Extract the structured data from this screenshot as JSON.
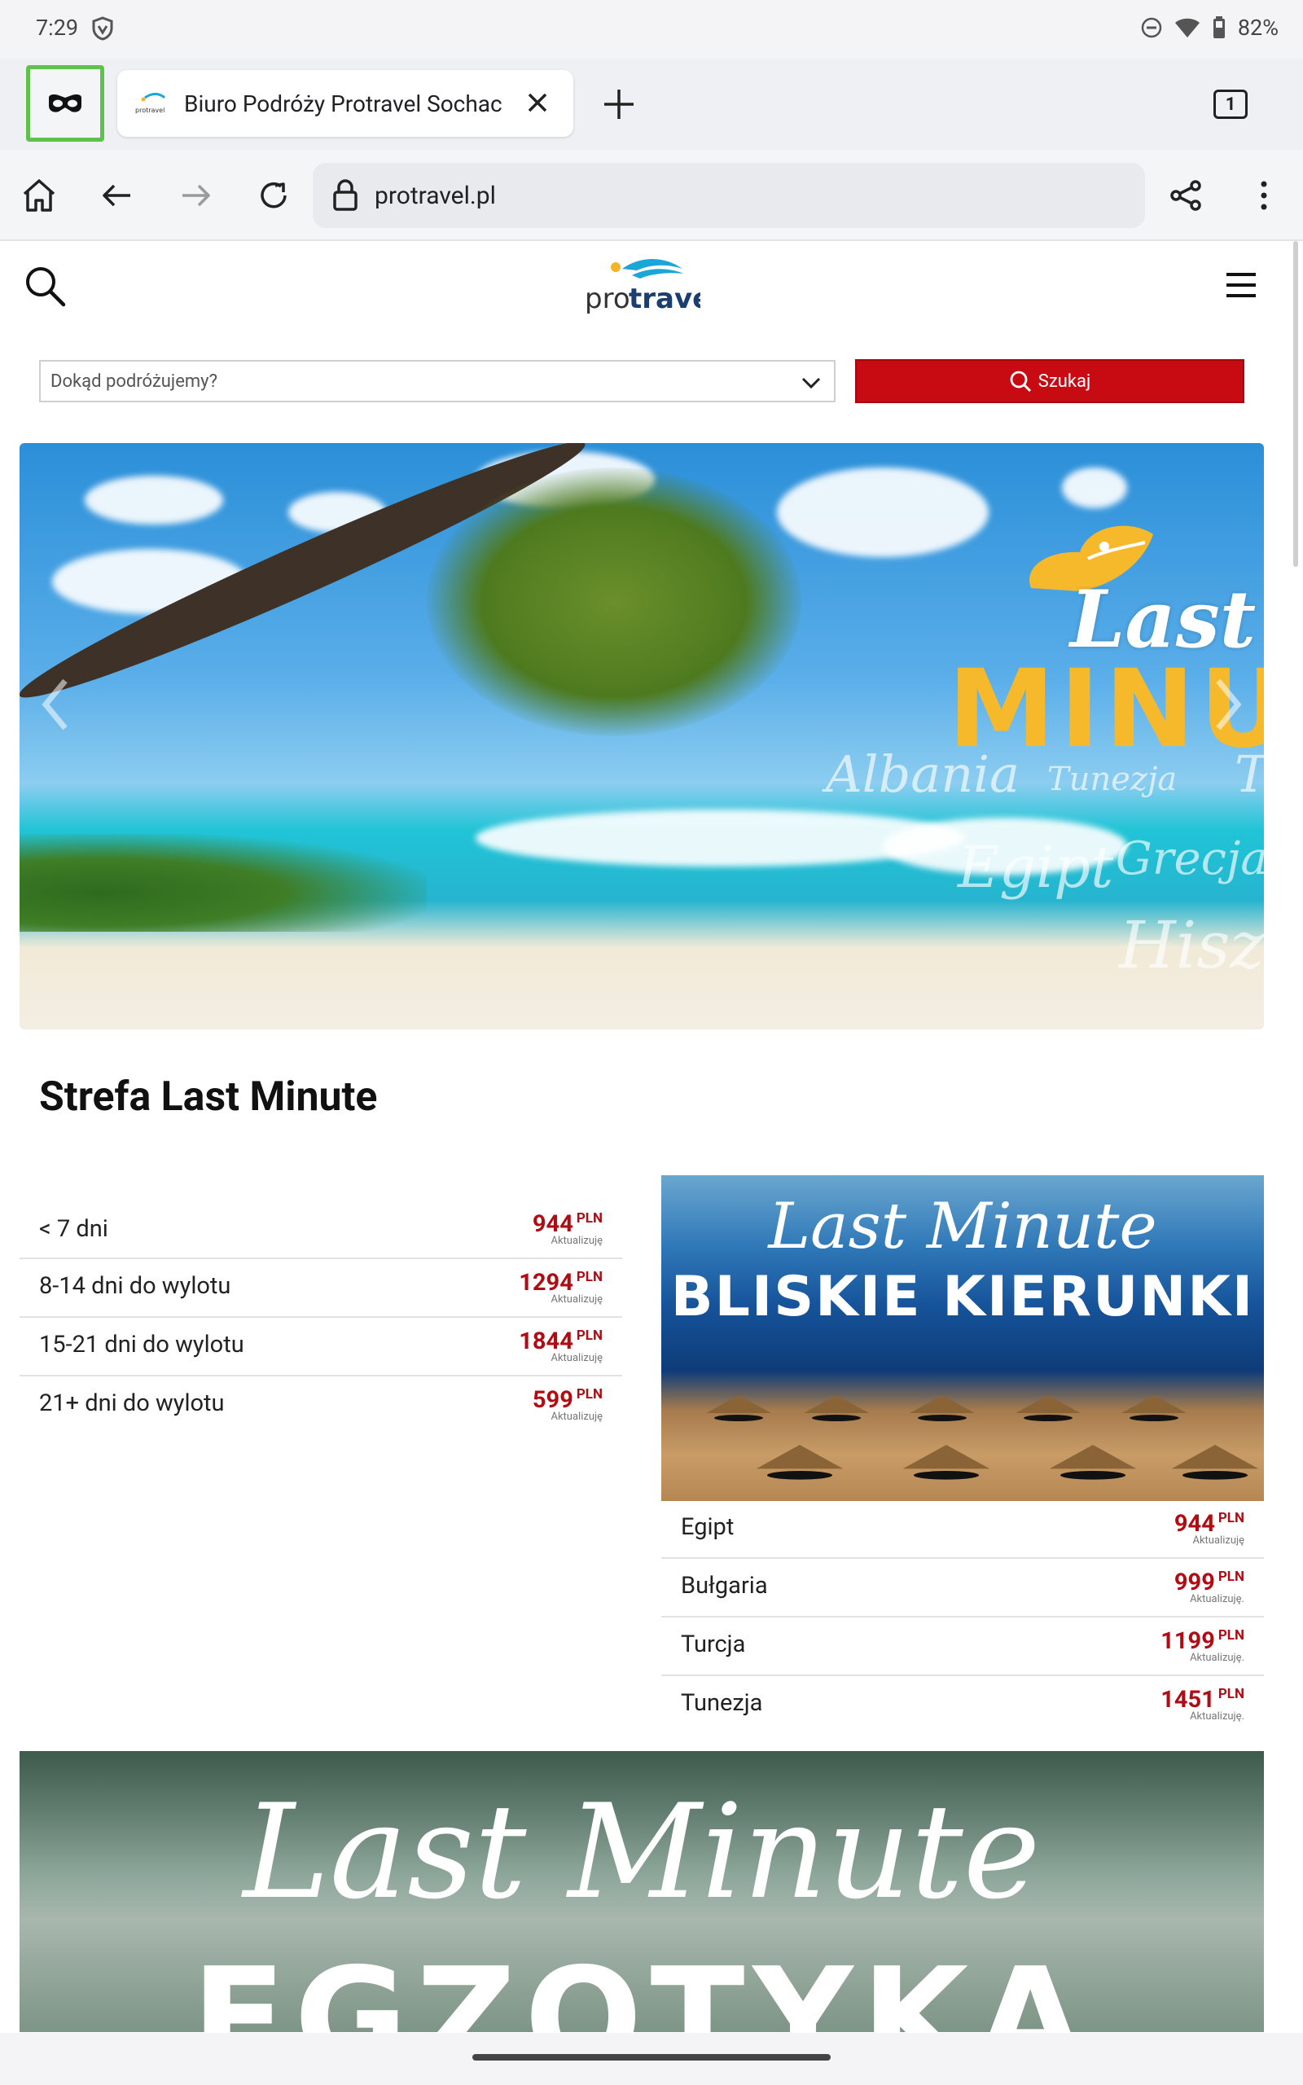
{
  "status": {
    "time": "7:29",
    "battery": "82%"
  },
  "browser": {
    "tab_title": "Biuro Podróży Protravel Sochaczew",
    "favicon_text": "protravel",
    "tab_count": "1",
    "url": "protravel.pl"
  },
  "site": {
    "logo_pre": "pro",
    "logo_bold": "travel",
    "destination_placeholder": "Dokąd podróżujemy?",
    "search_button": "Szukaj"
  },
  "hero": {
    "last": "Last",
    "minute": "MINUT",
    "words": [
      "Albania",
      "Tunezja",
      "T",
      "Egipt",
      "Grecja",
      "Hiszp"
    ]
  },
  "section": {
    "title": "Strefa Last Minute",
    "rows": [
      {
        "label": "< 7 dni",
        "price": "944",
        "currency": "PLN",
        "note": "Aktualizuję"
      },
      {
        "label": "8-14 dni do wylotu",
        "price": "1294",
        "currency": "PLN",
        "note": "Aktualizuję"
      },
      {
        "label": "15-21 dni do wylotu",
        "price": "1844",
        "currency": "PLN",
        "note": "Aktualizuję"
      },
      {
        "label": "21+ dni do wylotu",
        "price": "599",
        "currency": "PLN",
        "note": "Aktualizuję"
      }
    ]
  },
  "bliskie": {
    "script": "Last Minute",
    "big": "BLISKIE KIERUNKI",
    "rows": [
      {
        "label": "Egipt",
        "price": "944",
        "currency": "PLN",
        "note": "Aktualizuję"
      },
      {
        "label": "Bułgaria",
        "price": "999",
        "currency": "PLN",
        "note": "Aktualizuję."
      },
      {
        "label": "Turcja",
        "price": "1199",
        "currency": "PLN",
        "note": "Aktualizuję."
      },
      {
        "label": "Tunezja",
        "price": "1451",
        "currency": "PLN",
        "note": "Aktualizuję."
      }
    ]
  },
  "egzotyka": {
    "script": "Last Minute",
    "big": "EGZOTYKA"
  },
  "colors": {
    "accent_red": "#c80a12",
    "price_red": "#b10b13",
    "incognito_highlight": "#5ec24a"
  }
}
